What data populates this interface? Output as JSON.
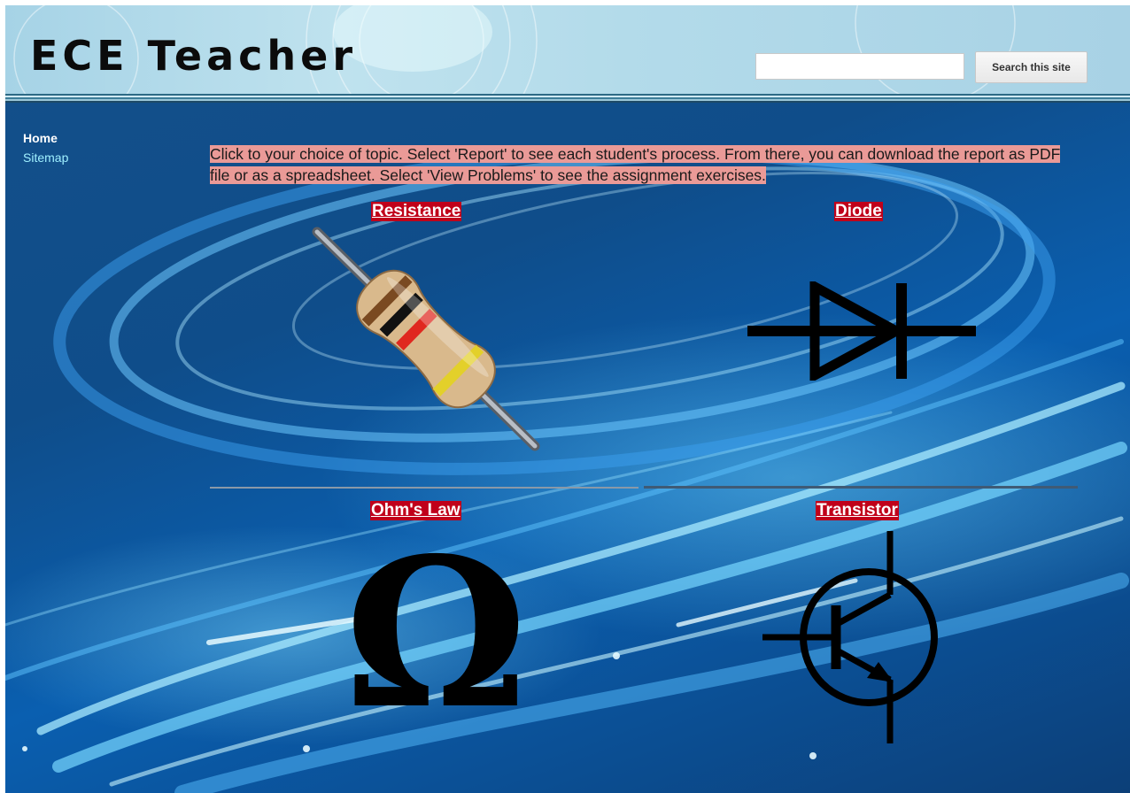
{
  "header": {
    "site_title": "ECE Teacher",
    "search_placeholder": "",
    "search_button_label": "Search this site"
  },
  "sidebar": {
    "items": [
      {
        "label": "Home",
        "current": true
      },
      {
        "label": "Sitemap",
        "current": false
      }
    ]
  },
  "main": {
    "intro_text": "Click to your choice of topic. Select 'Report' to see each student's process. From there, you can download the report as PDF file or as a spreadsheet. Select 'View Problems' to see the assignment exercises.",
    "topics": [
      {
        "label": "Resistance",
        "icon": "resistor-icon"
      },
      {
        "label": "Diode",
        "icon": "diode-symbol-icon"
      },
      {
        "label": "Ohm's Law",
        "icon": "omega-icon",
        "glyph": "Ω"
      },
      {
        "label": "Transistor",
        "icon": "transistor-symbol-icon"
      }
    ]
  },
  "colors": {
    "header_bg": "#b3dbea",
    "page_bg": "#0f4d8a",
    "topic_link_bg": "#c0001a",
    "intro_highlight": "#ea9a97",
    "sitemap_link": "#9ff0ff"
  }
}
